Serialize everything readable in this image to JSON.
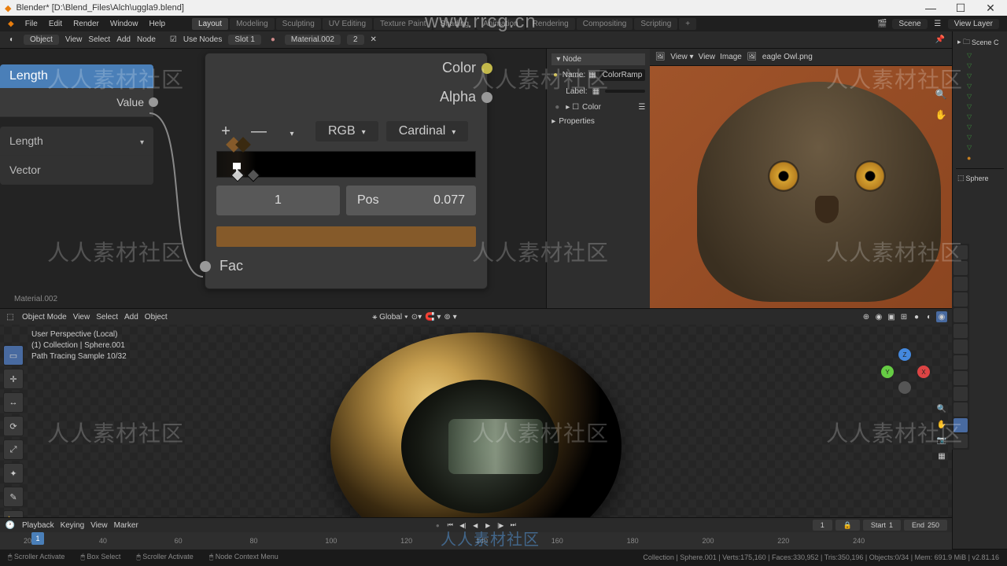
{
  "window": {
    "app": "Blender",
    "title": "Blender* [D:\\Blend_Files\\Alch\\uggla9.blend]"
  },
  "top_menu": {
    "items": [
      "File",
      "Edit",
      "Render",
      "Window",
      "Help"
    ],
    "tabs": [
      "Layout",
      "Modeling",
      "Sculpting",
      "UV Editing",
      "Texture Paint",
      "Shading",
      "Animation",
      "Rendering",
      "Compositing",
      "Scripting"
    ],
    "active_tab": "Layout",
    "scene": "Scene",
    "view_layer": "View Layer"
  },
  "row2": {
    "mode_left": "Object",
    "left_items": [
      "View",
      "Select",
      "Add",
      "Node"
    ],
    "use_nodes": "Use Nodes",
    "slot": "Slot 1",
    "material": "Material.002",
    "mat_users": "2",
    "image_header": {
      "view": "View",
      "image": "Image",
      "file": "eagle Owl.png"
    }
  },
  "length_node": {
    "title": "Length",
    "value": "Value",
    "type": "Length",
    "vector": "Vector"
  },
  "color_ramp": {
    "outputs": {
      "color": "Color",
      "alpha": "Alpha"
    },
    "mode": "RGB",
    "interp": "Cardinal",
    "index": "1",
    "pos_label": "Pos",
    "pos_value": "0.077",
    "fac": "Fac",
    "color_hex": "#855a2a"
  },
  "node_panel": {
    "header": "Node",
    "name_label": "Name:",
    "name": "ColorRamp",
    "label_label": "Label:",
    "color_label": "Color",
    "properties": "Properties"
  },
  "material_label": "Material.002",
  "viewport": {
    "mode": "Object Mode",
    "menu": [
      "View",
      "Select",
      "Add",
      "Object"
    ],
    "orientation": "Global",
    "overlay": {
      "l1": "User Perspective (Local)",
      "l2": "(1) Collection | Sphere.001",
      "l3": "Path Tracing Sample 10/32"
    }
  },
  "timeline": {
    "menu": [
      "Playback",
      "Keying",
      "View",
      "Marker"
    ],
    "current": "1",
    "start_label": "Start",
    "start": "1",
    "end_label": "End",
    "end": "250",
    "ticks": [
      "20",
      "40",
      "60",
      "80",
      "100",
      "120",
      "140",
      "160",
      "180",
      "200",
      "220",
      "240"
    ]
  },
  "status": {
    "l1": "Scroller Activate",
    "l2": "Box Select",
    "l3": "Scroller Activate",
    "l4": "Node Context Menu",
    "right": "Collection | Sphere.001 | Verts:175,160 | Faces:330,952 | Tris:350,196 | Objects:0/34 | Mem: 691.9 MiB | v2.81.16"
  },
  "outliner": {
    "root": "Scene C",
    "item": "Sphere"
  },
  "watermark": {
    "url": "www.rrcg.cn",
    "text": "人人素材社区"
  }
}
